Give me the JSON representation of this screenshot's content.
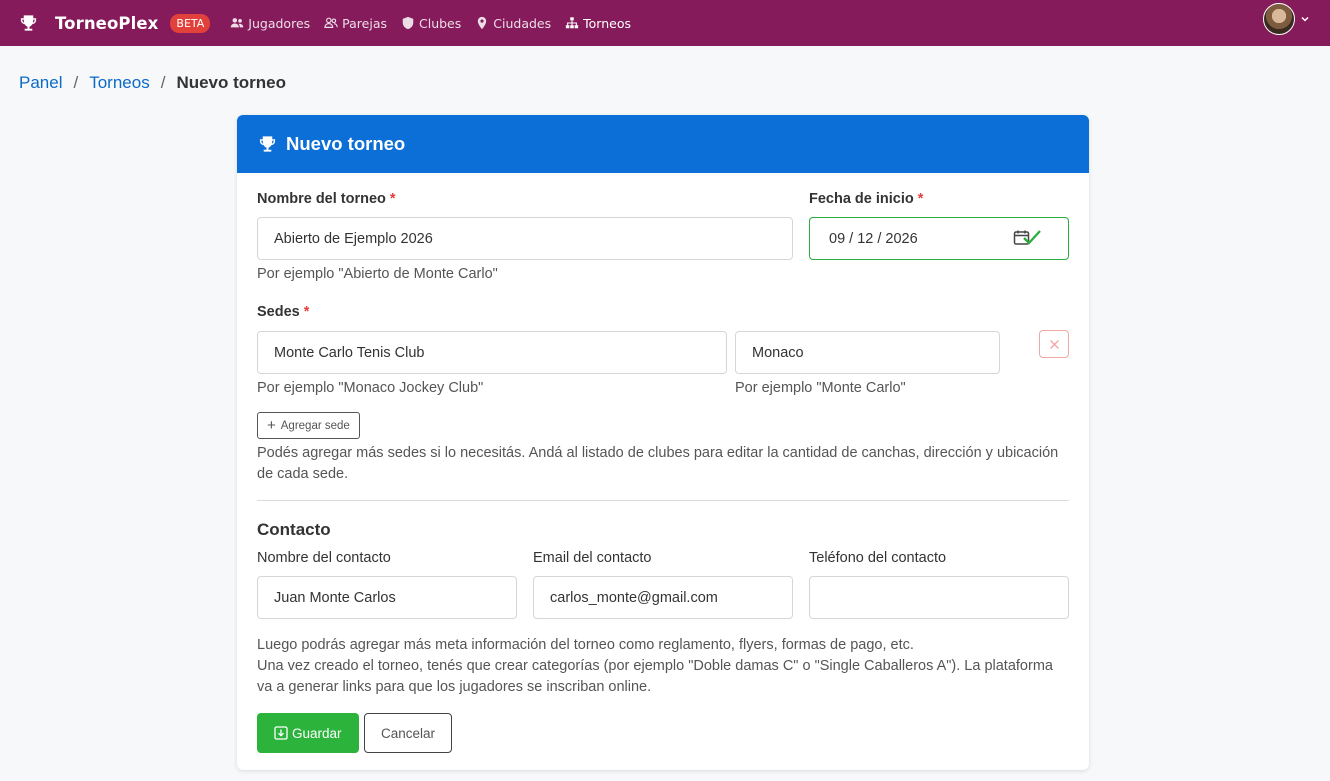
{
  "navbar": {
    "brand": "TorneoPlex",
    "badge": "BETA",
    "items": [
      {
        "label": "Jugadores",
        "icon": "users-icon"
      },
      {
        "label": "Parejas",
        "icon": "user-pair-icon"
      },
      {
        "label": "Clubes",
        "icon": "shield-icon"
      },
      {
        "label": "Ciudades",
        "icon": "map-pin-icon"
      },
      {
        "label": "Torneos",
        "icon": "sitemap-icon"
      }
    ],
    "colors": {
      "background": "#861b5b",
      "badge": "#e1413a"
    }
  },
  "breadcrumb": {
    "panel": "Panel",
    "torneos": "Torneos",
    "current": "Nuevo torneo"
  },
  "card": {
    "title": "Nuevo torneo",
    "header_color": "#0b6fd7"
  },
  "form": {
    "name": {
      "label": "Nombre del torneo",
      "required": "*",
      "value": "Abierto de Ejemplo 2026",
      "help": "Por ejemplo \"Abierto de Monte Carlo\""
    },
    "start_date": {
      "label": "Fecha de inicio",
      "required": "*",
      "value": "09 / 12 / 2026"
    },
    "venues": {
      "label": "Sedes",
      "required": "*",
      "club_value": "Monte Carlo Tenis Club",
      "club_help": "Por ejemplo \"Monaco Jockey Club\"",
      "city_value": "Monaco",
      "city_help": "Por ejemplo \"Monte Carlo\"",
      "add_button": "Agregar sede",
      "note": "Podés agregar más sedes si lo necesitás. Andá al listado de clubes para editar la cantidad de canchas, dirección y ubicación de cada sede."
    },
    "contact": {
      "title": "Contacto",
      "name_label": "Nombre del contacto",
      "name_value": "Juan Monte Carlos",
      "email_label": "Email del contacto",
      "email_value": "carlos_monte@gmail.com",
      "phone_label": "Teléfono del contacto",
      "phone_value": ""
    },
    "footer_note_1": "Luego podrás agregar más meta información del torneo como reglamento, flyers, formas de pago, etc.",
    "footer_note_2": "Una vez creado el torneo, tenés que crear categorías (por ejemplo \"Doble damas C\" o \"Single Caballeros A\"). La plataforma va a generar links para que los jugadores se inscriban online.",
    "save_button": "Guardar",
    "cancel_button": "Cancelar",
    "colors": {
      "save": "#2bb33c",
      "success_border": "#2cac3f"
    }
  }
}
